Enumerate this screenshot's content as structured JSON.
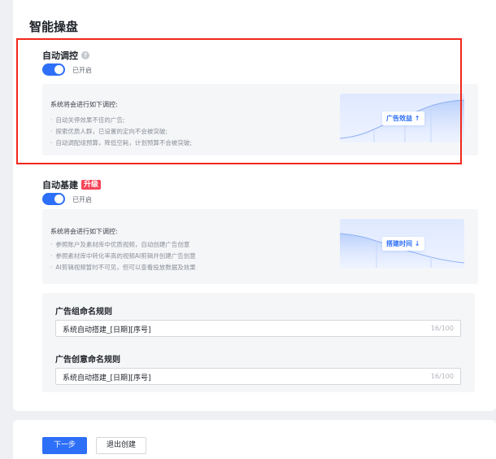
{
  "page": {
    "title": "智能操盘"
  },
  "auto_control": {
    "title": "自动调控",
    "help_icon": "question-circle-icon",
    "toggle_label": "已开启",
    "toggle_on": true,
    "info_heading": "系统将会进行如下调控:",
    "info_items": [
      "自动关停效果不佳的广告;",
      "探索优质人群，已设置的定向不会被突破;",
      "自动调配组预算，降低空耗，计划预算不会被突破;"
    ],
    "illustration_label": "广告效益 ↑"
  },
  "auto_build": {
    "title": "自动基建",
    "badge": "升级",
    "toggle_label": "已开启",
    "toggle_on": true,
    "info_heading": "系统将会进行如下调控:",
    "info_items": [
      "参照账户及素材库中优质视频，自动创建广告创意",
      "参照素材库中转化率高的视频AI剪辑并创建广告创意",
      "AI剪辑视频暂时不可见，但可以查看投放数据及效果"
    ],
    "illustration_label": "搭建时间 ↓"
  },
  "naming": {
    "group_label": "广告组命名规则",
    "group_value": "系统自动搭建_[日期][序号]",
    "group_count": "16/100",
    "creative_label": "广告创意命名规则",
    "creative_value": "系统自动搭建_[日期][序号]",
    "creative_count": "16/100"
  },
  "footer": {
    "next_label": "下一步",
    "exit_label": "退出创建"
  },
  "colors": {
    "primary": "#2d6ff7",
    "highlight_border": "#f2271c",
    "badge": "#f5465a"
  }
}
